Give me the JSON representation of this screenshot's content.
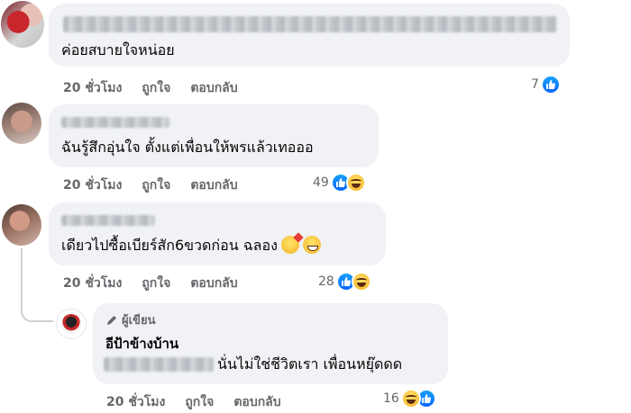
{
  "comments": [
    {
      "text": "ค่อยสบายใจหน่อย",
      "time": "20 ชั่วโมง",
      "like": "ถูกใจ",
      "reply": "ตอบกลับ",
      "reaction_count": "7",
      "reactions": [
        "like-icon"
      ]
    },
    {
      "text": "ฉันรู้สึกอุ่นใจ ตั้งแต่เพื่อนให้พรแล้วเทอออ",
      "time": "20 ชั่วโมง",
      "like": "ถูกใจ",
      "reply": "ตอบกลับ",
      "reaction_count": "49",
      "reactions": [
        "like-icon",
        "haha-icon"
      ]
    },
    {
      "text": "เดียวไปซื้อเบียร์สัก6ขวดก่อน ฉลอง",
      "emojis": [
        "partying-face-emoji",
        "grinning-face-emoji"
      ],
      "time": "20 ชั่วโมง",
      "like": "ถูกใจ",
      "reply": "ตอบกลับ",
      "reaction_count": "28",
      "reactions": [
        "like-icon",
        "haha-icon"
      ]
    }
  ],
  "reply": {
    "badge": "ผู้เขียน",
    "author": "อีป้าข้างบ้าน",
    "text": "นั่นไม่ใช่ชีวิตเรา เพื่อนหยุ๊ดดด",
    "time": "20 ชั่วโมง",
    "like": "ถูกใจ",
    "reply": "ตอบกลับ",
    "reaction_count": "16",
    "reactions": [
      "haha-icon",
      "like-icon"
    ]
  },
  "colors": {
    "bubble": "#f0f2f5",
    "meta_text": "#65676b",
    "like_blue": "#0866ff"
  }
}
